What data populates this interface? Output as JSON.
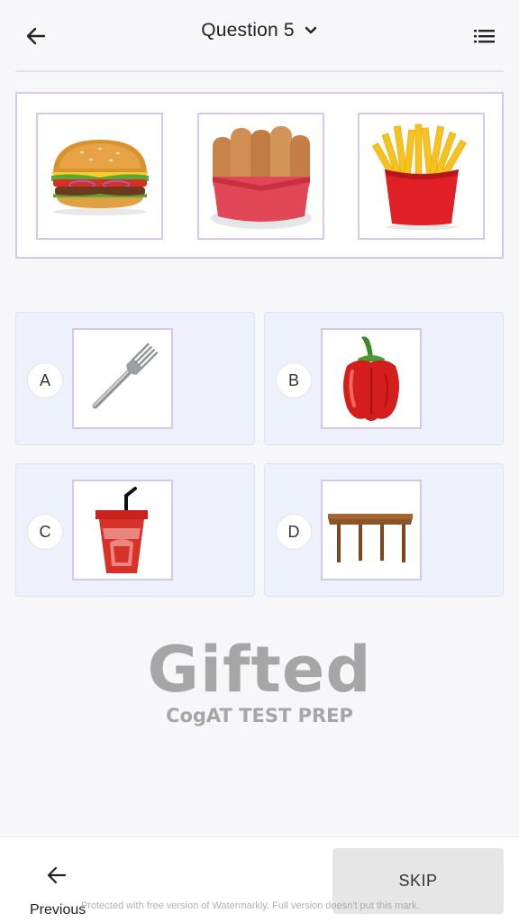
{
  "header": {
    "title": "Question 5",
    "back_icon": "arrow-left-icon",
    "dropdown_icon": "chevron-down-icon",
    "menu_icon": "list-icon"
  },
  "question": {
    "images": [
      "hamburger",
      "chicken-fingers",
      "french-fries"
    ]
  },
  "answers": [
    {
      "letter": "A",
      "image": "fork"
    },
    {
      "letter": "B",
      "image": "red-bell-pepper"
    },
    {
      "letter": "C",
      "image": "soda-cup"
    },
    {
      "letter": "D",
      "image": "wooden-table"
    }
  ],
  "branding": {
    "logo_main": "Gifted",
    "logo_sub": "CogAT TEST PREP"
  },
  "footer": {
    "previous_label": "Previous",
    "skip_label": "SKIP",
    "watermark": "Protected with free version of Watermarkly. Full version doesn't put this mark."
  },
  "colors": {
    "background": "#f7f7fa",
    "image_border": "#d6c8e8",
    "answer_card": "#eef0fb",
    "skip_button": "#e6e6e6",
    "logo_gray": "#a6a6a6"
  }
}
